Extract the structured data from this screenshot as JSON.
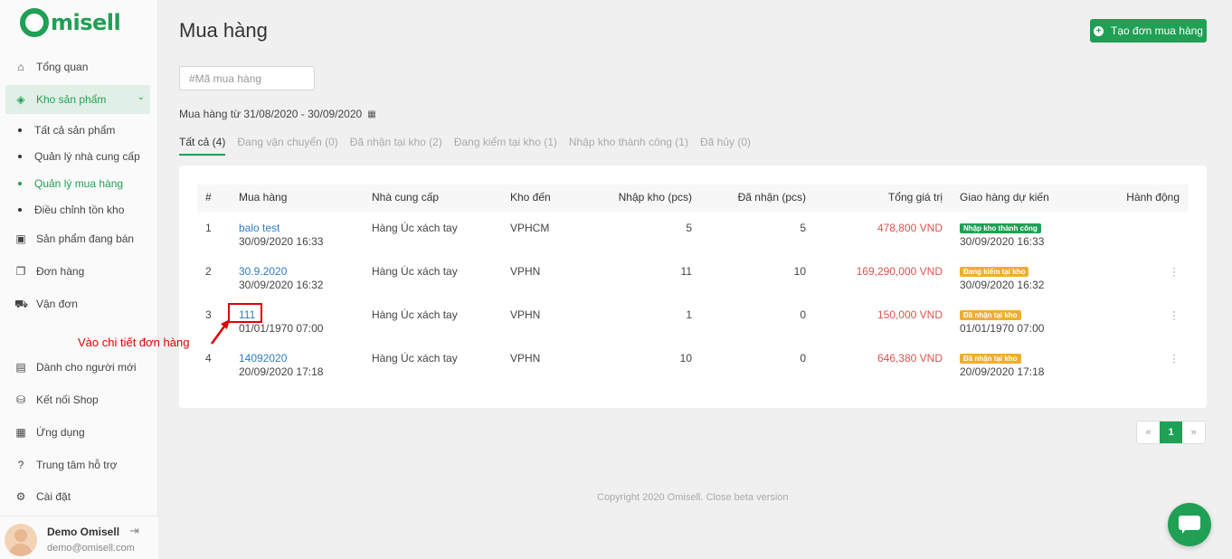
{
  "brand": {
    "name": "misell"
  },
  "sidebar": {
    "items": [
      {
        "label": "Tổng quan",
        "icon": "home-icon"
      },
      {
        "label": "Kho sản phẩm",
        "icon": "box-icon"
      },
      {
        "label": "Sản phẩm đang bán",
        "icon": "shop-icon"
      },
      {
        "label": "Đơn hàng",
        "icon": "orders-icon"
      },
      {
        "label": "Vận đơn",
        "icon": "truck-icon"
      },
      {
        "label": "Dành cho người mới",
        "icon": "book-icon"
      },
      {
        "label": "Kết nối Shop",
        "icon": "cart-icon"
      },
      {
        "label": "Ứng dụng",
        "icon": "apps-icon"
      },
      {
        "label": "Trung tâm hỗ trợ",
        "icon": "help-icon"
      },
      {
        "label": "Cài đặt",
        "icon": "gear-icon"
      }
    ],
    "sub_items": [
      {
        "label": "Tất cả sản phẩm"
      },
      {
        "label": "Quản lý nhà cung cấp"
      },
      {
        "label": "Quản lý mua hàng"
      },
      {
        "label": "Điều chỉnh tồn kho"
      }
    ],
    "user": {
      "name": "Demo Omisell",
      "email": "demo@omisell.com"
    }
  },
  "header": {
    "title": "Mua hàng",
    "create_label": "Tạo đơn mua hàng"
  },
  "search": {
    "placeholder": "#Mã mua hàng",
    "value": ""
  },
  "filter": {
    "date_range": "Mua hàng từ 31/08/2020 - 30/09/2020"
  },
  "tabs": [
    {
      "label": "Tất cả (4)"
    },
    {
      "label": "Đang vận chuyển (0)"
    },
    {
      "label": "Đã nhận tại kho (2)"
    },
    {
      "label": "Đang kiểm tại kho (1)"
    },
    {
      "label": "Nhập kho thành công (1)"
    },
    {
      "label": "Đã hủy (0)"
    }
  ],
  "table": {
    "columns": [
      "#",
      "Mua hàng",
      "Nhà cung cấp",
      "Kho đến",
      "Nhập kho (pcs)",
      "Đã nhận (pcs)",
      "Tổng giá trị",
      "Giao hàng dự kiến",
      "Hành động"
    ],
    "rows": [
      {
        "no": "1",
        "code": "balo test",
        "date": "30/09/2020 16:33",
        "supplier": "Hàng Úc xách tay",
        "warehouse": "VPHCM",
        "import": "5",
        "received": "5",
        "total": "478,800 VND",
        "status": "Nhập kho thành công",
        "status_color": "#1fa055",
        "expected": "30/09/2020 16:33",
        "has_action": false
      },
      {
        "no": "2",
        "code": "30.9.2020",
        "date": "30/09/2020 16:32",
        "supplier": "Hàng Úc xách tay",
        "warehouse": "VPHN",
        "import": "11",
        "received": "10",
        "total": "169,290,000 VND",
        "status": "Đang kiểm tại kho",
        "status_color": "#f0ad2e",
        "expected": "30/09/2020 16:32",
        "has_action": true
      },
      {
        "no": "3",
        "code": "111",
        "date": "01/01/1970 07:00",
        "supplier": "Hàng Úc xách tay",
        "warehouse": "VPHN",
        "import": "1",
        "received": "0",
        "total": "150,000 VND",
        "status": "Đã nhận tại kho",
        "status_color": "#f0ad2e",
        "expected": "01/01/1970 07:00",
        "has_action": true
      },
      {
        "no": "4",
        "code": "14092020",
        "date": "20/09/2020 17:18",
        "supplier": "Hàng Úc xách tay",
        "warehouse": "VPHN",
        "import": "10",
        "received": "0",
        "total": "646,380 VND",
        "status": "Đã nhận tại kho",
        "status_color": "#f0ad2e",
        "expected": "20/09/2020 17:18",
        "has_action": true
      }
    ]
  },
  "pagination": {
    "prev": "«",
    "current": "1",
    "next": "»"
  },
  "annotation": {
    "text": "Vào chi tiết đơn hàng"
  },
  "footer": {
    "copyright": "Copyright 2020 Omisell. Close beta version"
  },
  "colors": {
    "accent": "#1fa055",
    "link": "#2f7cc9",
    "money": "#d9534f",
    "annotation": "#e00000"
  }
}
